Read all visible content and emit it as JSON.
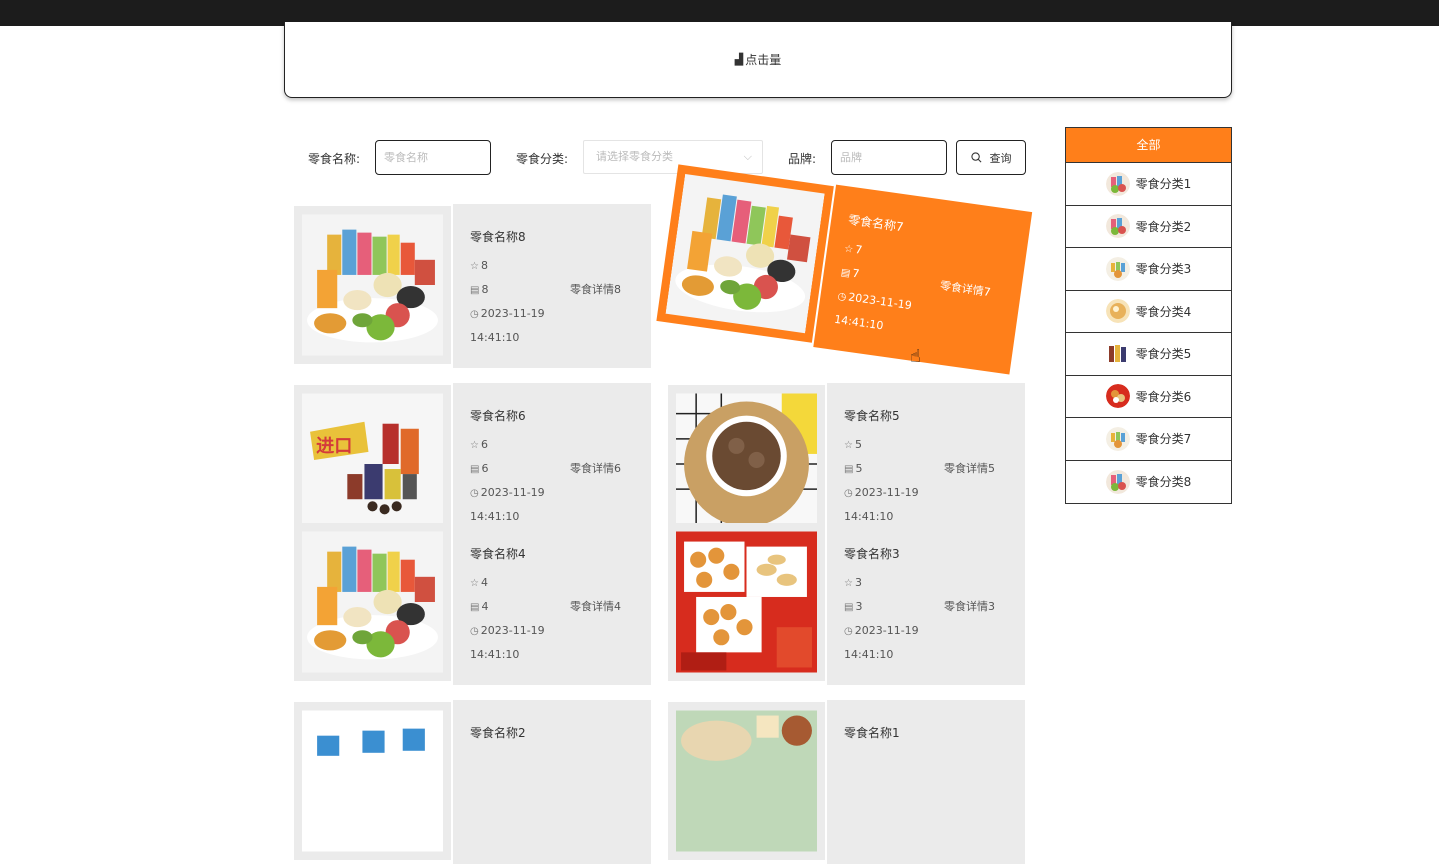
{
  "header": {
    "hits_icon": "bar-chart-icon",
    "hits_label": "点击量"
  },
  "search": {
    "name_label": "零食名称:",
    "name_placeholder": "零食名称",
    "category_label": "零食分类:",
    "category_placeholder": "请选择零食分类",
    "brand_label": "品牌:",
    "brand_placeholder": "品牌",
    "search_button": "查询"
  },
  "cards": [
    {
      "name": "零食名称8",
      "stars": "8",
      "comments": "8",
      "detail": "零食详情8",
      "date": "2023-11-19",
      "time": "14:41:10",
      "image": "snack-assortment"
    },
    {
      "name": "零食名称7",
      "stars": "7",
      "comments": "7",
      "detail": "零食详情7",
      "date": "2023-11-19",
      "time": "14:41:10",
      "image": "snack-assortment"
    },
    {
      "name": "零食名称6",
      "stars": "6",
      "comments": "6",
      "detail": "零食详情6",
      "date": "2023-11-19",
      "time": "14:41:10",
      "image": "imported-snacks"
    },
    {
      "name": "零食名称5",
      "stars": "5",
      "comments": "5",
      "detail": "零食详情5",
      "date": "2023-11-19",
      "time": "14:41:10",
      "image": "chocolate-crisps"
    },
    {
      "name": "零食名称4",
      "stars": "4",
      "comments": "4",
      "detail": "零食详情4",
      "date": "2023-11-19",
      "time": "14:41:10",
      "image": "snack-assortment"
    },
    {
      "name": "零食名称3",
      "stars": "3",
      "comments": "3",
      "detail": "零食详情3",
      "date": "2023-11-19",
      "time": "14:41:10",
      "image": "fried-snacks"
    },
    {
      "name": "零食名称2",
      "image": "blue-packages"
    },
    {
      "name": "零食名称1",
      "image": "green-plate"
    }
  ],
  "sidebar": {
    "all_label": "全部",
    "items": [
      {
        "label": "零食分类1"
      },
      {
        "label": "零食分类2"
      },
      {
        "label": "零食分类3"
      },
      {
        "label": "零食分类4"
      },
      {
        "label": "零食分类5"
      },
      {
        "label": "零食分类6"
      },
      {
        "label": "零食分类7"
      },
      {
        "label": "零食分类8"
      }
    ]
  },
  "colors": {
    "accent": "#ff7f1a",
    "card_bg": "#ebebeb",
    "topbar": "#1c1c1c"
  }
}
